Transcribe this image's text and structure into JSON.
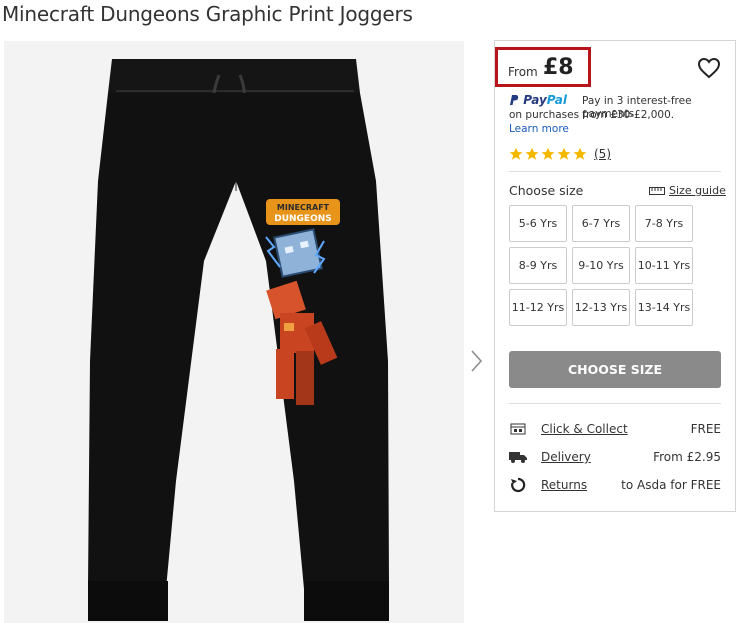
{
  "product": {
    "title": "Minecraft Dungeons Graphic Print Joggers",
    "image_logo_line1": "MINECRAFT",
    "image_logo_line2": "DUNGEONS"
  },
  "price": {
    "from_label": "From",
    "value": "£8"
  },
  "paypal": {
    "brand_p1": "Pay",
    "brand_p2": "Pal",
    "line1": "Pay in 3 interest-free payments",
    "line2": "on purchases from £30-£2,000.",
    "learn_more": "Learn more"
  },
  "rating": {
    "stars": 5,
    "count_label": "(5)",
    "star_color": "#f5b800"
  },
  "sizes": {
    "label": "Choose size",
    "guide_label": "Size guide",
    "options": [
      "5-6 Yrs",
      "6-7 Yrs",
      "7-8 Yrs",
      "8-9 Yrs",
      "9-10 Yrs",
      "10-11 Yrs",
      "11-12 Yrs",
      "12-13 Yrs",
      "13-14 Yrs"
    ]
  },
  "cta": {
    "label": "CHOOSE SIZE"
  },
  "services": [
    {
      "icon": "click-collect-icon",
      "label": "Click & Collect",
      "value": "FREE"
    },
    {
      "icon": "delivery-truck-icon",
      "label": "Delivery",
      "value": "From £2.95"
    },
    {
      "icon": "returns-icon",
      "label": "Returns",
      "value": "to Asda for FREE"
    }
  ],
  "colors": {
    "highlight_border": "#b8141c",
    "cta_bg": "#8a8a8a",
    "link_blue": "#1a5bb8"
  }
}
